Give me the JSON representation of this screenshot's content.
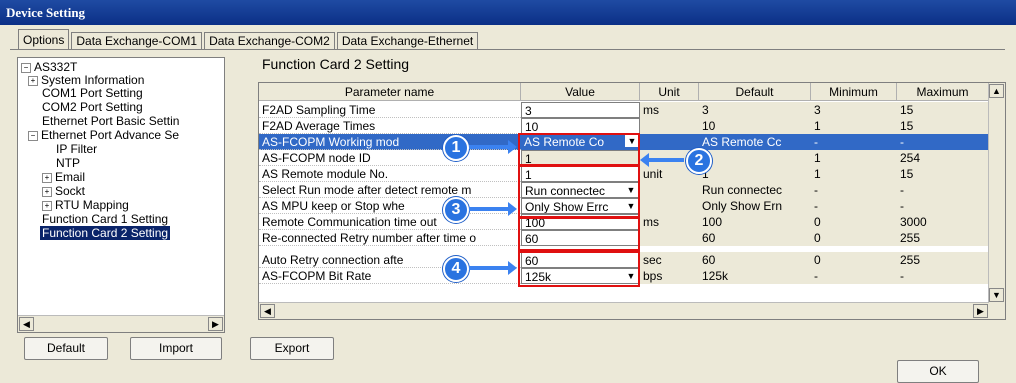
{
  "window": {
    "title": "Device Setting"
  },
  "tabs": [
    "Options",
    "Data Exchange-COM1",
    "Data Exchange-COM2",
    "Data Exchange-Ethernet"
  ],
  "tree": {
    "root": "AS332T",
    "items": [
      "System Information",
      "COM1 Port Setting",
      "COM2 Port Setting",
      "Ethernet Port Basic Settin",
      "Ethernet Port Advance Se",
      "IP Filter",
      "NTP",
      "Email",
      "Sockt",
      "RTU Mapping",
      "Function Card 1 Setting",
      "Function Card 2 Setting"
    ]
  },
  "section_title": "Function Card 2 Setting",
  "grid": {
    "columns": [
      "Parameter name",
      "Value",
      "Unit",
      "Default",
      "Minimum",
      "Maximum"
    ],
    "rows": [
      {
        "name": "F2AD Sampling Time",
        "value": "3",
        "unit": "ms",
        "default": "3",
        "min": "3",
        "max": "15"
      },
      {
        "name": "F2AD Average Times",
        "value": "10",
        "unit": "",
        "default": "10",
        "min": "1",
        "max": "15"
      },
      {
        "name": "AS-FCOPM Working mod",
        "value": "AS Remote Co",
        "unit": "",
        "default": "AS Remote Cc",
        "min": "-",
        "max": "-"
      },
      {
        "name": "AS-FCOPM node ID",
        "value": "1",
        "unit": "",
        "default": "1",
        "min": "1",
        "max": "254"
      },
      {
        "name": "AS Remote module No.",
        "value": "1",
        "unit": "unit",
        "default": "1",
        "min": "1",
        "max": "15"
      },
      {
        "name": "Select Run mode after detect remote m",
        "value": "Run connectec",
        "unit": "",
        "default": "Run connectec",
        "min": "-",
        "max": "-"
      },
      {
        "name": "AS MPU keep or Stop whe",
        "value": "Only Show Errc",
        "unit": "",
        "default": "Only Show Ern",
        "min": "-",
        "max": "-"
      },
      {
        "name": "Remote Communication time out",
        "value": "100",
        "unit": "ms",
        "default": "100",
        "min": "0",
        "max": "3000"
      },
      {
        "name": "Re-connected Retry number after time o",
        "value": "60",
        "unit": "",
        "default": "60",
        "min": "0",
        "max": "255"
      },
      {
        "name": "Auto Retry connection afte",
        "value": "60",
        "unit": "sec",
        "default": "60",
        "min": "0",
        "max": "255"
      },
      {
        "name": "AS-FCOPM Bit Rate",
        "value": "125k",
        "unit": "bps",
        "default": "125k",
        "min": "-",
        "max": "-"
      }
    ]
  },
  "badges": [
    "1",
    "2",
    "3",
    "4"
  ],
  "buttons": {
    "default": "Default",
    "import": "Import",
    "export": "Export",
    "ok": "OK"
  }
}
